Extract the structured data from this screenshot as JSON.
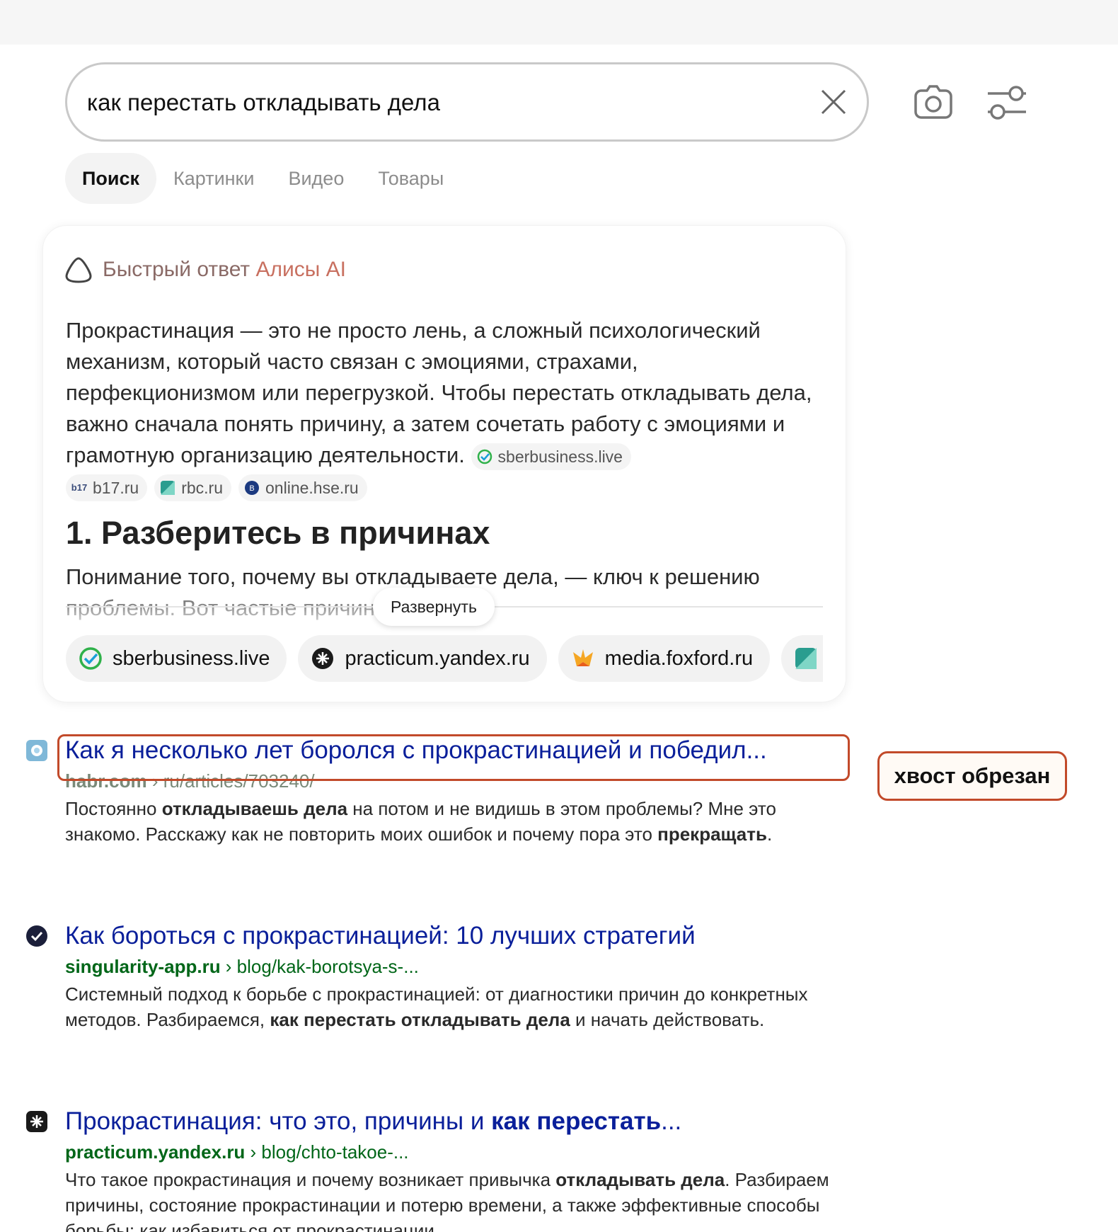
{
  "search": {
    "query": "как перестать откладывать дела"
  },
  "tabs": [
    {
      "label": "Поиск",
      "active": true
    },
    {
      "label": "Картинки",
      "active": false
    },
    {
      "label": "Видео",
      "active": false
    },
    {
      "label": "Товары",
      "active": false
    }
  ],
  "ai_answer": {
    "title_prefix": "Быстрый ответ",
    "title_brand": "Алисы AI",
    "intro": "Прокрастинация — это не просто лень, а сложный психологический механизм, который часто связан с эмоциями, страхами, перфекционизмом или перегрузкой. Чтобы перестать откладывать дела, важно сначала понять причину, а затем сочетать работу с эмоциями и грамотную организацию деятельности.",
    "inline_sources": [
      "sberbusiness.live",
      "b17.ru",
      "rbc.ru",
      "online.hse.ru"
    ],
    "heading": "1. Разберитесь в причинах",
    "paragraph": "Понимание того, почему вы откладываете дела, — ключ к решению проблемы. Вот частые причины:",
    "expand_label": "Развернуть",
    "sources": [
      "sberbusiness.live",
      "practicum.yandex.ru",
      "media.foxford.ru"
    ]
  },
  "results": [
    {
      "title": "Как я несколько лет боролся с прокрастинацией и победил...",
      "domain": "habr.com",
      "path": " › ru/articles/703240/",
      "snippet": [
        "Постоянно ",
        "откладываешь дела",
        " на потом и не видишь в этом проблемы? Мне это знакомо. Расскажу как не повторить моих ошибок и почему пора это ",
        "пре­кращать",
        "."
      ]
    },
    {
      "title": "Как бороться с прокрастинацией: 10 лучших стратегий",
      "domain": "singularity-app.ru",
      "path": " › blog/kak-borotsya-s-...",
      "snippet": [
        "Системный подход к борьбе с прокрастинацией: от диагностики причин до конкретных методов. Разбираемся, ",
        "как перестать откладывать дела",
        " и на­чать действовать."
      ]
    },
    {
      "title_plain": "Прокрастинация: что это, причины и ",
      "title_bold": "как перестать",
      "title_tail": "...",
      "domain": "practicum.yandex.ru",
      "path": " › blog/chto-takoe-...",
      "snippet": [
        "Что такое прокрастинация и почему возникает привычка ",
        "откладывать дела",
        ". Разбираем причины, состояние прокрастинации и потерю времени, а также эффективные способы борьбы: как избавиться от прокрастинации."
      ]
    }
  ],
  "annotation": {
    "label": "хвост обрезан"
  },
  "colors": {
    "link": "#0a1f9a",
    "url": "#006618",
    "annotation": "#c24a2a",
    "alice_accent": "#c87060"
  }
}
